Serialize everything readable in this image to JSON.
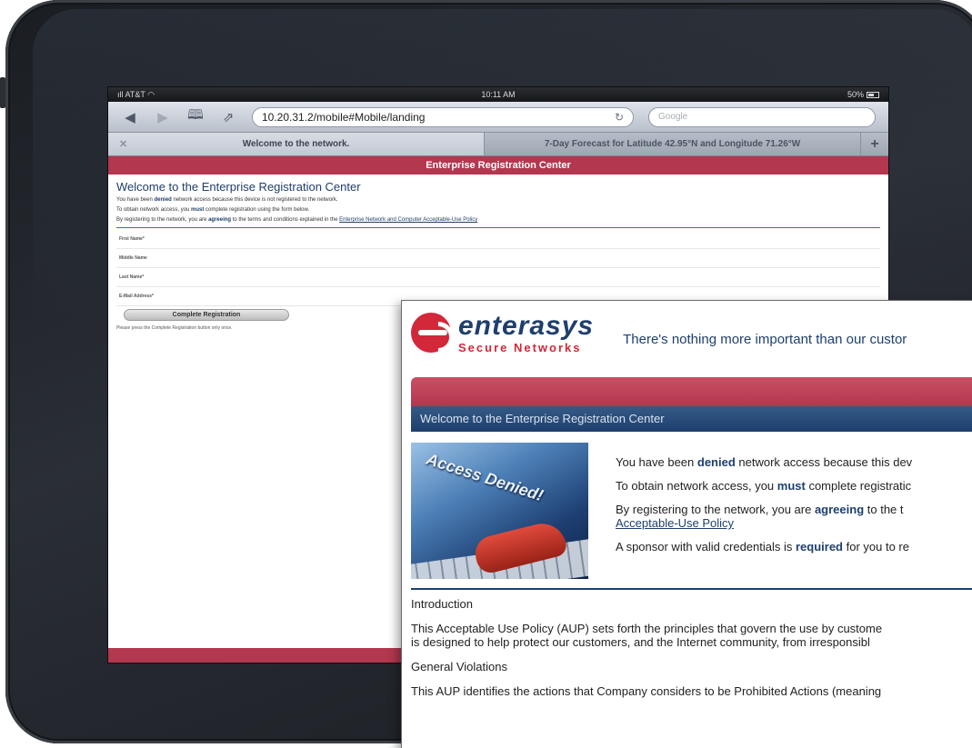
{
  "statusbar": {
    "carrier": "AT&T",
    "time": "10:11 AM",
    "battery": "50%"
  },
  "toolbar": {
    "back_icon": "back-arrow-icon",
    "forward_icon": "forward-arrow-icon",
    "url": "10.20.31.2/mobile#Mobile/landing",
    "search_placeholder": "Google"
  },
  "tabs": [
    {
      "label": "Welcome to the network.",
      "active": true
    },
    {
      "label": "7-Day Forecast for Latitude 42.95°N and Longitude 71.26°W",
      "active": false
    }
  ],
  "page": {
    "header": "Enterprise Registration Center",
    "title": "Welcome to the Enterprise Registration Center",
    "line1_pre": "You have been ",
    "line1_bold": "denied",
    "line1_post": " network access because this device is not registered to the network.",
    "line2_pre": "To obtain network access, you ",
    "line2_bold": "must",
    "line2_post": " complete registration using the form below.",
    "line3_pre": "By registering to the network, you are ",
    "line3_bold": "agreeing",
    "line3_mid": " to the terms and conditions explained in the ",
    "line3_link": "Enterprise Network and Computer Acceptable-Use Policy",
    "fields": [
      "First Name*",
      "Middle Name",
      "Last Name*",
      "E-Mail Address*"
    ],
    "button": "Complete Registration",
    "note": "Please press the Complete Registration button only once."
  },
  "overlay": {
    "brand_name": "enterasys",
    "brand_sub": "Secure Networks",
    "tagline": "There's nothing more important than our custor",
    "welcome": "Welcome to the Enterprise Registration Center",
    "image_text": "Access Denied!",
    "p1_pre": "You have been ",
    "p1_bold": "denied",
    "p1_post": " network access because this dev",
    "p2_pre": "To obtain network access, you ",
    "p2_bold": "must",
    "p2_post": " complete registratic",
    "p3_pre": "By registering to the network, you are ",
    "p3_bold": "agreeing",
    "p3_post": " to the t",
    "p3_link": "Acceptable-Use Policy",
    "p4_pre": "A sponsor with valid credentials is ",
    "p4_bold": "required",
    "p4_post": " for you to re",
    "aup_intro_heading": "Introduction",
    "aup_intro_line1": "This Acceptable Use Policy (AUP) sets forth the principles that govern the use by custome",
    "aup_intro_line2": "is designed to help protect our customers, and the Internet community, from irresponsibl",
    "aup_gv_heading": "General Violations",
    "aup_gv_line1": "This AUP identifies the actions that Company considers to be Prohibited Actions (meaning"
  },
  "colors": {
    "brand_red": "#b3374f",
    "brand_blue": "#1e3f6e"
  }
}
